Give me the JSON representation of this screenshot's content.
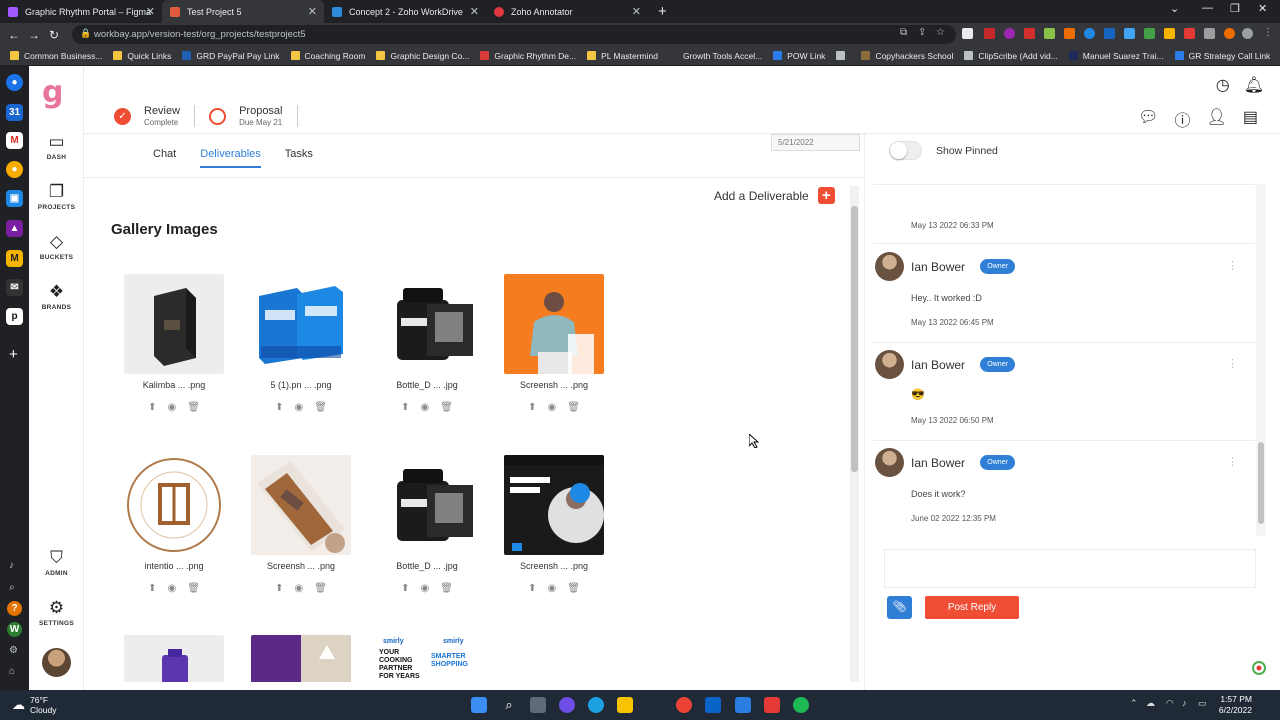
{
  "browser": {
    "tabs": [
      {
        "title": "Graphic Rhythm Portal – Figma",
        "color": "#a259ff",
        "active": false
      },
      {
        "title": "Test Project 5",
        "color": "#e25b3c",
        "active": true
      },
      {
        "title": "Concept 2 - Zoho WorkDrive",
        "color": "#2d8cd9",
        "active": false
      },
      {
        "title": "Zoho Annotator",
        "color": "#e0383e",
        "active": false
      }
    ],
    "url": "workbay.app/version-test/org_projects/testproject5",
    "bookmarks": [
      {
        "label": "Common Business...",
        "color": "#f4c542"
      },
      {
        "label": "Quick Links",
        "color": "#f4c542"
      },
      {
        "label": "GRD PayPal Pay Link",
        "color": "#1f5fb4"
      },
      {
        "label": "Coaching Room",
        "color": "#f4c542"
      },
      {
        "label": "Graphic Design Co...",
        "color": "#f4c542"
      },
      {
        "label": "Graphic Rhythm De...",
        "color": "#d93b3b"
      },
      {
        "label": "PL Mastermind",
        "color": "#f4c542"
      },
      {
        "label": "Growth Tools Accel...",
        "color": "#35363a"
      },
      {
        "label": "POW Link",
        "color": "#2b7de9"
      },
      {
        "label": "",
        "color": "#bdc1c6"
      },
      {
        "label": "Copyhackers School",
        "color": "#8a6d3b"
      },
      {
        "label": "ClipScribe (Add vid...",
        "color": "#bdc1c6"
      },
      {
        "label": "Manuel Suarez Trai...",
        "color": "#1e2a5a"
      },
      {
        "label": "GR Strategy Call Link",
        "color": "#2b7de9"
      }
    ]
  },
  "sidebar": {
    "logo": "g",
    "items": [
      {
        "label": "DASH",
        "icon": "monitor-icon"
      },
      {
        "label": "PROJECTS",
        "icon": "projects-icon"
      },
      {
        "label": "BUCKETS",
        "icon": "buckets-icon"
      },
      {
        "label": "BRANDS",
        "icon": "brands-icon"
      },
      {
        "label": "ADMIN",
        "icon": "shield-icon"
      },
      {
        "label": "SETTINGS",
        "icon": "gear-icon"
      }
    ]
  },
  "stages": [
    {
      "name": "Review",
      "sub": "Complete",
      "done": true
    },
    {
      "name": "Proposal",
      "sub": "Due May 21",
      "done": false
    }
  ],
  "project_date": "5/21/2022",
  "tabs": [
    {
      "label": "Chat",
      "active": false
    },
    {
      "label": "Deliverables",
      "active": true
    },
    {
      "label": "Tasks",
      "active": false
    }
  ],
  "deliverables": {
    "add_label": "Add a Deliverable",
    "section_title": "Gallery Images",
    "items": [
      {
        "name": "Kalimba ... .png"
      },
      {
        "name": "5 (1).pn ... .png"
      },
      {
        "name": "Bottle_D ... .jpg"
      },
      {
        "name": "Screensh ... .png"
      },
      {
        "name": "intentio ... .png"
      },
      {
        "name": "Screensh ... .png"
      },
      {
        "name": "Bottle_D ... .jpg"
      },
      {
        "name": "Screensh ... .png"
      }
    ],
    "partial_row": {
      "card3_brand_a": "smirly",
      "card3_brand_b": "smirly",
      "card3_headline_a": "YOUR COOKING PARTNER FOR YEARS",
      "card3_headline_b": "SMARTER SHOPPING"
    }
  },
  "chat": {
    "pinned_label": "Show Pinned",
    "first_time": "May 13 2022 06:33 PM",
    "messages": [
      {
        "author": "Ian Bower",
        "badge": "Owner",
        "text": "Hey.. It worked :D",
        "time": "May 13 2022 06:45 PM"
      },
      {
        "author": "Ian Bower",
        "badge": "Owner",
        "text": "😎",
        "time": "May 13 2022 06:50 PM"
      },
      {
        "author": "Ian Bower",
        "badge": "Owner",
        "text": "Does it work?",
        "time": "June 02 2022 12:35 PM"
      }
    ],
    "post_label": "Post Reply"
  },
  "taskbar": {
    "weather_temp": "76°F",
    "weather_desc": "Cloudy",
    "time": "1:57 PM",
    "date": "6/2/2022"
  }
}
